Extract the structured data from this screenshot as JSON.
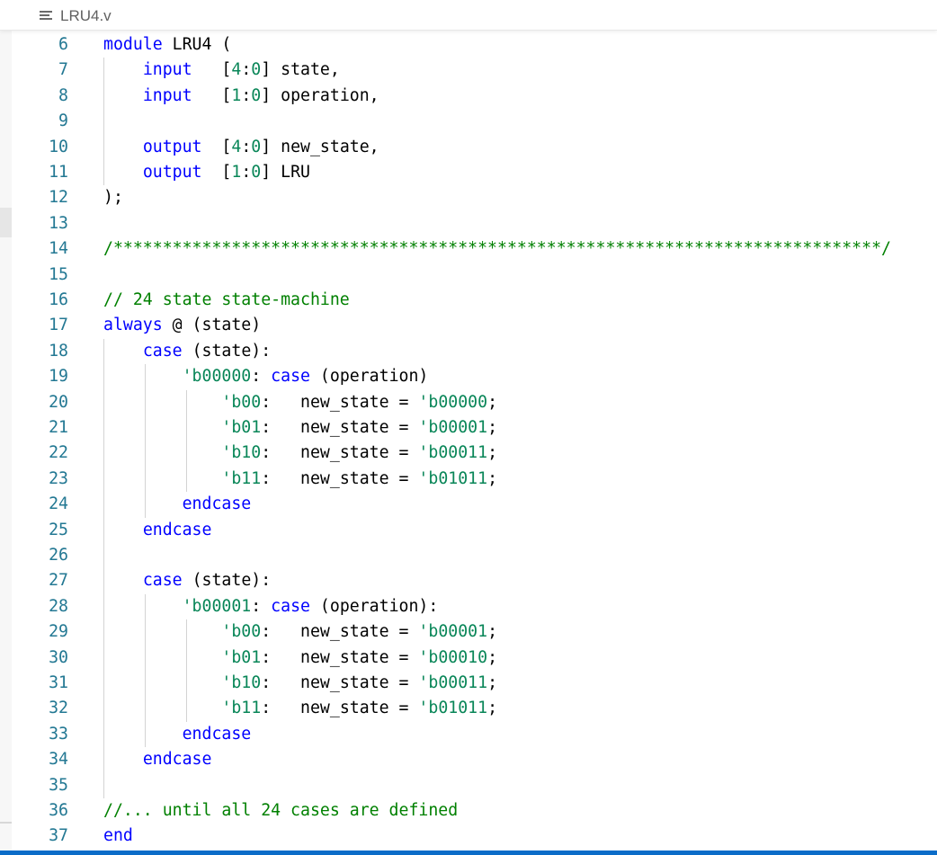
{
  "tab": {
    "icon": "menu-lines-icon",
    "filename": "LRU4.v"
  },
  "code_lines": [
    {
      "n": "6",
      "tokens": [
        {
          "t": "module",
          "c": "kw"
        },
        {
          "t": " LRU4 (",
          "c": ""
        }
      ]
    },
    {
      "n": "7",
      "tokens": [
        {
          "t": "    ",
          "c": ""
        },
        {
          "t": "input",
          "c": "kw"
        },
        {
          "t": "   [",
          "c": ""
        },
        {
          "t": "4",
          "c": "num"
        },
        {
          "t": ":",
          "c": ""
        },
        {
          "t": "0",
          "c": "num"
        },
        {
          "t": "] state,",
          "c": ""
        }
      ]
    },
    {
      "n": "8",
      "tokens": [
        {
          "t": "    ",
          "c": ""
        },
        {
          "t": "input",
          "c": "kw"
        },
        {
          "t": "   [",
          "c": ""
        },
        {
          "t": "1",
          "c": "num"
        },
        {
          "t": ":",
          "c": ""
        },
        {
          "t": "0",
          "c": "num"
        },
        {
          "t": "] operation,",
          "c": ""
        }
      ]
    },
    {
      "n": "9",
      "tokens": []
    },
    {
      "n": "10",
      "tokens": [
        {
          "t": "    ",
          "c": ""
        },
        {
          "t": "output",
          "c": "kw"
        },
        {
          "t": "  [",
          "c": ""
        },
        {
          "t": "4",
          "c": "num"
        },
        {
          "t": ":",
          "c": ""
        },
        {
          "t": "0",
          "c": "num"
        },
        {
          "t": "] new_state,",
          "c": ""
        }
      ]
    },
    {
      "n": "11",
      "tokens": [
        {
          "t": "    ",
          "c": ""
        },
        {
          "t": "output",
          "c": "kw"
        },
        {
          "t": "  [",
          "c": ""
        },
        {
          "t": "1",
          "c": "num"
        },
        {
          "t": ":",
          "c": ""
        },
        {
          "t": "0",
          "c": "num"
        },
        {
          "t": "] LRU",
          "c": ""
        }
      ]
    },
    {
      "n": "12",
      "tokens": [
        {
          "t": ");",
          "c": ""
        }
      ]
    },
    {
      "n": "13",
      "tokens": []
    },
    {
      "n": "14",
      "tokens": [
        {
          "t": "/******************************************************************************/",
          "c": "cm"
        }
      ]
    },
    {
      "n": "15",
      "tokens": []
    },
    {
      "n": "16",
      "tokens": [
        {
          "t": "// 24 state state-machine",
          "c": "cm"
        }
      ]
    },
    {
      "n": "17",
      "tokens": [
        {
          "t": "always",
          "c": "kw"
        },
        {
          "t": " @ (state)",
          "c": ""
        }
      ]
    },
    {
      "n": "18",
      "tokens": [
        {
          "t": "    ",
          "c": ""
        },
        {
          "t": "case",
          "c": "kw"
        },
        {
          "t": " (state):",
          "c": ""
        }
      ]
    },
    {
      "n": "19",
      "tokens": [
        {
          "t": "        ",
          "c": ""
        },
        {
          "t": "'b00000",
          "c": "num"
        },
        {
          "t": ": ",
          "c": ""
        },
        {
          "t": "case",
          "c": "kw"
        },
        {
          "t": " (operation)",
          "c": ""
        }
      ]
    },
    {
      "n": "20",
      "tokens": [
        {
          "t": "            ",
          "c": ""
        },
        {
          "t": "'b00",
          "c": "num"
        },
        {
          "t": ":   new_state = ",
          "c": ""
        },
        {
          "t": "'b00000",
          "c": "num"
        },
        {
          "t": ";",
          "c": ""
        }
      ]
    },
    {
      "n": "21",
      "tokens": [
        {
          "t": "            ",
          "c": ""
        },
        {
          "t": "'b01",
          "c": "num"
        },
        {
          "t": ":   new_state = ",
          "c": ""
        },
        {
          "t": "'b00001",
          "c": "num"
        },
        {
          "t": ";",
          "c": ""
        }
      ]
    },
    {
      "n": "22",
      "tokens": [
        {
          "t": "            ",
          "c": ""
        },
        {
          "t": "'b10",
          "c": "num"
        },
        {
          "t": ":   new_state = ",
          "c": ""
        },
        {
          "t": "'b00011",
          "c": "num"
        },
        {
          "t": ";",
          "c": ""
        }
      ]
    },
    {
      "n": "23",
      "tokens": [
        {
          "t": "            ",
          "c": ""
        },
        {
          "t": "'b11",
          "c": "num"
        },
        {
          "t": ":   new_state = ",
          "c": ""
        },
        {
          "t": "'b01011",
          "c": "num"
        },
        {
          "t": ";",
          "c": ""
        }
      ]
    },
    {
      "n": "24",
      "tokens": [
        {
          "t": "        ",
          "c": ""
        },
        {
          "t": "endcase",
          "c": "kw"
        }
      ]
    },
    {
      "n": "25",
      "tokens": [
        {
          "t": "    ",
          "c": ""
        },
        {
          "t": "endcase",
          "c": "kw"
        }
      ]
    },
    {
      "n": "26",
      "tokens": []
    },
    {
      "n": "27",
      "tokens": [
        {
          "t": "    ",
          "c": ""
        },
        {
          "t": "case",
          "c": "kw"
        },
        {
          "t": " (state):",
          "c": ""
        }
      ]
    },
    {
      "n": "28",
      "tokens": [
        {
          "t": "        ",
          "c": ""
        },
        {
          "t": "'b00001",
          "c": "num"
        },
        {
          "t": ": ",
          "c": ""
        },
        {
          "t": "case",
          "c": "kw"
        },
        {
          "t": " (operation):",
          "c": ""
        }
      ]
    },
    {
      "n": "29",
      "tokens": [
        {
          "t": "            ",
          "c": ""
        },
        {
          "t": "'b00",
          "c": "num"
        },
        {
          "t": ":   new_state = ",
          "c": ""
        },
        {
          "t": "'b00001",
          "c": "num"
        },
        {
          "t": ";",
          "c": ""
        }
      ]
    },
    {
      "n": "30",
      "tokens": [
        {
          "t": "            ",
          "c": ""
        },
        {
          "t": "'b01",
          "c": "num"
        },
        {
          "t": ":   new_state = ",
          "c": ""
        },
        {
          "t": "'b00010",
          "c": "num"
        },
        {
          "t": ";",
          "c": ""
        }
      ]
    },
    {
      "n": "31",
      "tokens": [
        {
          "t": "            ",
          "c": ""
        },
        {
          "t": "'b10",
          "c": "num"
        },
        {
          "t": ":   new_state = ",
          "c": ""
        },
        {
          "t": "'b00011",
          "c": "num"
        },
        {
          "t": ";",
          "c": ""
        }
      ]
    },
    {
      "n": "32",
      "tokens": [
        {
          "t": "            ",
          "c": ""
        },
        {
          "t": "'b11",
          "c": "num"
        },
        {
          "t": ":   new_state = ",
          "c": ""
        },
        {
          "t": "'b01011",
          "c": "num"
        },
        {
          "t": ";",
          "c": ""
        }
      ]
    },
    {
      "n": "33",
      "tokens": [
        {
          "t": "        ",
          "c": ""
        },
        {
          "t": "endcase",
          "c": "kw"
        }
      ]
    },
    {
      "n": "34",
      "tokens": [
        {
          "t": "    ",
          "c": ""
        },
        {
          "t": "endcase",
          "c": "kw"
        }
      ]
    },
    {
      "n": "35",
      "tokens": []
    },
    {
      "n": "36",
      "tokens": [
        {
          "t": "//... until all 24 cases are defined",
          "c": "cm"
        }
      ]
    },
    {
      "n": "37",
      "tokens": [
        {
          "t": "end",
          "c": "kw"
        }
      ]
    }
  ],
  "colors": {
    "keyword": "#0000ff",
    "number": "#098658",
    "comment": "#008000",
    "line_number": "#237893",
    "status_bar": "#0a6cc8"
  }
}
